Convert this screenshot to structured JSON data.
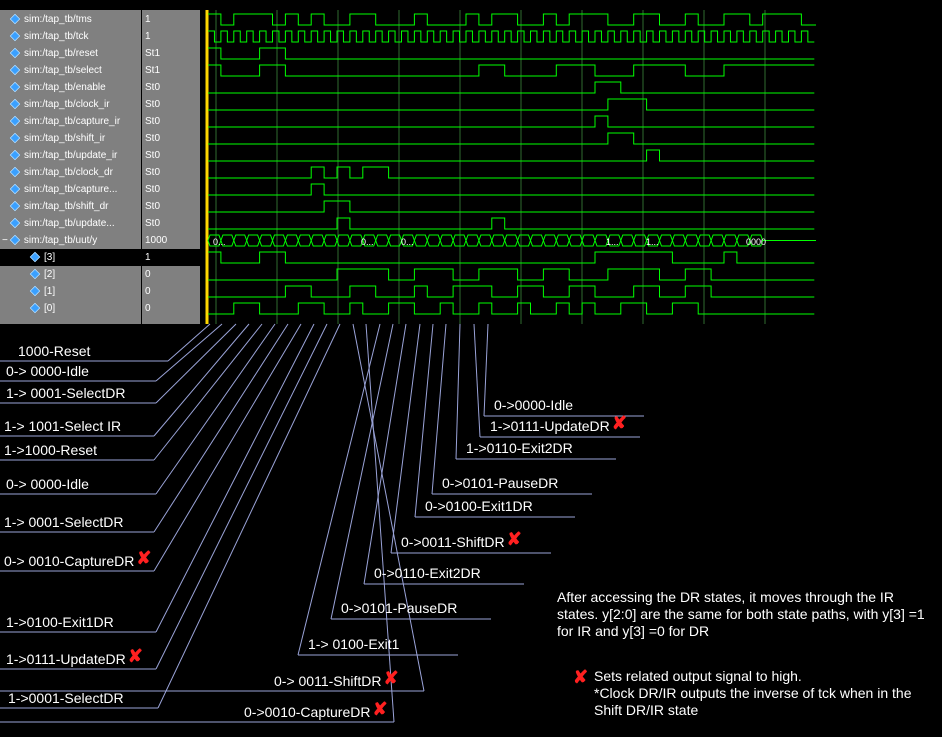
{
  "signals": [
    {
      "name": "sim:/tap_tb/tms",
      "value": "1"
    },
    {
      "name": "sim:/tap_tb/tck",
      "value": "1"
    },
    {
      "name": "sim:/tap_tb/reset",
      "value": "St1"
    },
    {
      "name": "sim:/tap_tb/select",
      "value": "St1"
    },
    {
      "name": "sim:/tap_tb/enable",
      "value": "St0"
    },
    {
      "name": "sim:/tap_tb/clock_ir",
      "value": "St0"
    },
    {
      "name": "sim:/tap_tb/capture_ir",
      "value": "St0"
    },
    {
      "name": "sim:/tap_tb/shift_ir",
      "value": "St0"
    },
    {
      "name": "sim:/tap_tb/update_ir",
      "value": "St0"
    },
    {
      "name": "sim:/tap_tb/clock_dr",
      "value": "St0"
    },
    {
      "name": "sim:/tap_tb/capture...",
      "value": "St0"
    },
    {
      "name": "sim:/tap_tb/shift_dr",
      "value": "St0"
    },
    {
      "name": "sim:/tap_tb/update...",
      "value": "St0"
    },
    {
      "name": "sim:/tap_tb/uut/y",
      "value": "1000"
    },
    {
      "name": "[3]",
      "value": "1"
    },
    {
      "name": "[2]",
      "value": "0"
    },
    {
      "name": "[1]",
      "value": "0"
    },
    {
      "name": "[0]",
      "value": "0"
    }
  ],
  "bus_labels": [
    "0...",
    "0...",
    "0...",
    "1...",
    "1...",
    "0000"
  ],
  "left_annotations": [
    "1000-Reset",
    "0-> 0000-Idle",
    "1-> 0001-SelectDR",
    "1-> 1001-Select IR",
    "1->1000-Reset",
    "0-> 0000-Idle",
    "1-> 0001-SelectDR",
    "0-> 0010-CaptureDR",
    "1->0100-Exit1DR",
    "1->0111-UpdateDR",
    "1->0001-SelectDR",
    "0-> 0011-ShiftDR",
    "0->0010-CaptureDR"
  ],
  "right_annotations": [
    "1-> 0100-Exit1",
    "0->0101-PauseDR",
    "0->0110-Exit2DR",
    "0->0011-ShiftDR",
    "0->0100-Exit1DR",
    "0->0101-PauseDR",
    "1->0110-Exit2DR",
    "1->0111-UpdateDR",
    "0->0000-Idle"
  ],
  "note": "After accessing the DR states, it moves through the IR states.  y[2:0] are the same for both state paths, with y[3] =1 for IR and y[3] =0 for DR",
  "legend": "Sets related output signal to high.\n*Clock DR/IR outputs the inverse of tck when in the Shift DR/IR state",
  "colors": {
    "wave": "#00ff00",
    "grid": "#2f6b2f",
    "cursor": "#ffd700",
    "pane": "#808080",
    "mark": "#ff2020",
    "icon": "#3aa0ff"
  }
}
